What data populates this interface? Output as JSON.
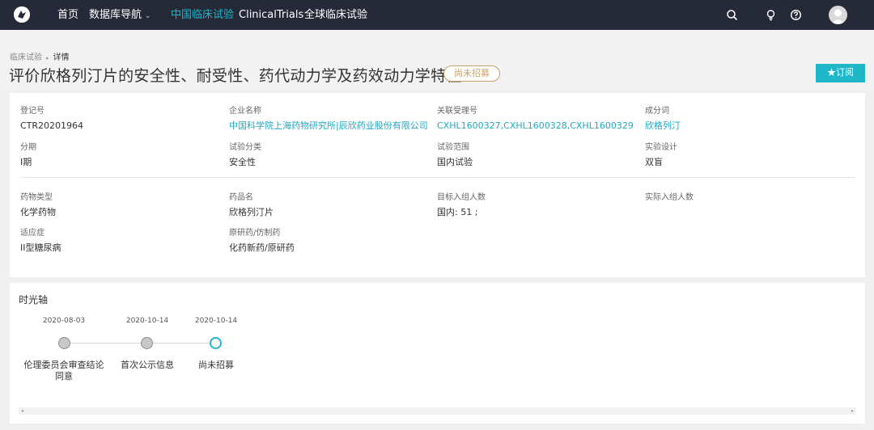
{
  "nav": {
    "items": [
      {
        "label": "首页",
        "active": false
      },
      {
        "label": "数据库导航",
        "active": false,
        "dropdown": true
      },
      {
        "label": "中国临床试验",
        "active": true
      },
      {
        "label": "ClinicalTrials",
        "active": false
      },
      {
        "label": "全球临床试验",
        "active": false
      }
    ],
    "dropdown_caret": "⌄",
    "icons": [
      "search-icon",
      "lightbulb-icon",
      "help-icon",
      "user-avatar"
    ]
  },
  "breadcrumb": {
    "parent": "临床试验",
    "separator": "▸",
    "current": "详情"
  },
  "title": "评价欣格列汀片的安全性、耐受性、药代动力学及药效动力学特征",
  "status": "尚未招募",
  "subscribe_label": "★订阅",
  "details": {
    "reg_no": {
      "label": "登记号",
      "value": "CTR20201964"
    },
    "company": {
      "label": "企业名称",
      "value": "中国科学院上海药物研究所|辰欣药业股份有限公司"
    },
    "related_no": {
      "label": "关联受理号",
      "value": "CXHL1600327,CXHL1600328,CXHL1600329"
    },
    "ingredient": {
      "label": "成分词",
      "value": "欣格列汀"
    },
    "phase": {
      "label": "分期",
      "value": "I期"
    },
    "category": {
      "label": "试验分类",
      "value": "安全性"
    },
    "scope": {
      "label": "试验范围",
      "value": "国内试验"
    },
    "design": {
      "label": "实验设计",
      "value": "双盲"
    },
    "drug_type": {
      "label": "药物类型",
      "value": "化学药物"
    },
    "drug_name": {
      "label": "药品名",
      "value": "欣格列汀片"
    },
    "target_enroll": {
      "label": "目标入组人数",
      "value": "国内: 51 ;"
    },
    "actual_enroll": {
      "label": "实际入组人数",
      "value": ""
    },
    "indication": {
      "label": "适应症",
      "value": "II型糖尿病"
    },
    "original_generic": {
      "label": "原研药/仿制药",
      "value": "化药新药/原研药"
    }
  },
  "timeline": {
    "title": "时光轴",
    "events": [
      {
        "date": "2020-08-03",
        "label": "伦理委员会审查结论同意"
      },
      {
        "date": "2020-10-14",
        "label": "首次公示信息"
      },
      {
        "date": "2020-10-14",
        "label": "尚未招募",
        "current": true
      }
    ]
  },
  "colors": {
    "accent": "#1fb6c9",
    "topbar": "#262a38",
    "status": "#c9a06a"
  }
}
